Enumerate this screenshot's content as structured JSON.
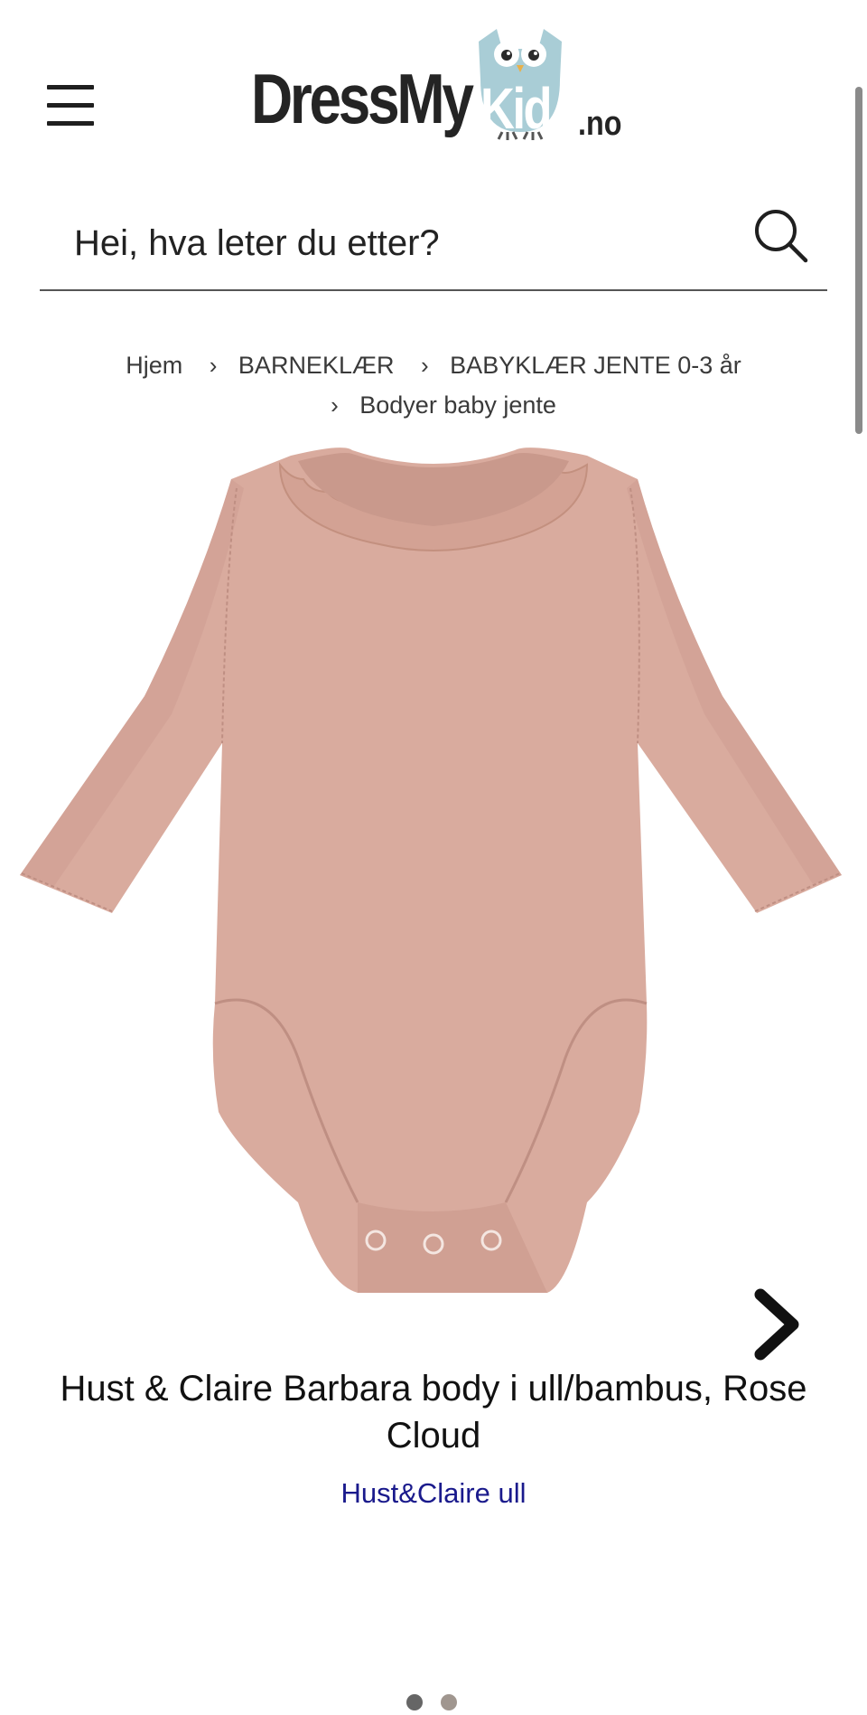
{
  "header": {
    "menu_icon": "hamburger-menu-icon",
    "logo": {
      "text_dress": "DressMy",
      "text_kid": "Kid",
      "text_domain": ".no"
    }
  },
  "search": {
    "placeholder": "Hei, hva leter du etter?",
    "icon": "search-icon"
  },
  "breadcrumb": {
    "items": [
      {
        "label": "Hjem"
      },
      {
        "label": "BARNEKLÆR"
      },
      {
        "label": "BABYKLÆR JENTE 0-3 år"
      },
      {
        "label": "Bodyer baby jente"
      }
    ],
    "separator_icon": "chevron-right-icon"
  },
  "gallery": {
    "image_subject": "long-sleeve baby body with ruffle collar",
    "next_icon": "chevron-right-icon",
    "slide_count": 2,
    "active_slide": 1
  },
  "product": {
    "title": "Hust & Claire Barbara body i ull/bambus, Rose Cloud",
    "brand": "Hust&Claire ull"
  },
  "colors": {
    "product_fabric": "#d9ab9e",
    "brand_link": "#1a1a8c",
    "owl": "#a9cdd6",
    "text": "#1f1f1f"
  }
}
